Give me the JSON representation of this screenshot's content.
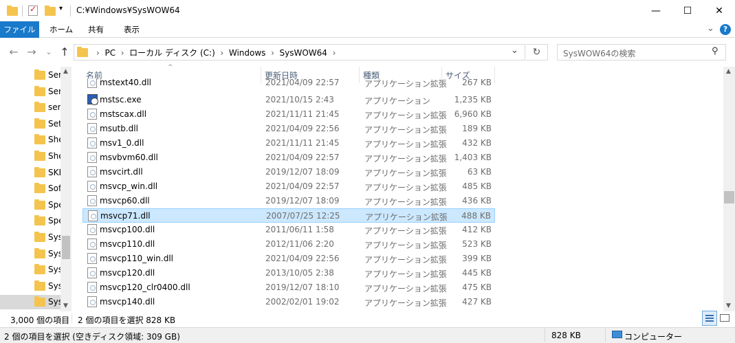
{
  "window": {
    "title": "C:¥Windows¥SysWOW64",
    "minimize": "—",
    "maximize": "☐",
    "close": "✕"
  },
  "ribbon": {
    "tabs": [
      "ファイル",
      "ホーム",
      "共有",
      "表示"
    ],
    "expand": "⌄",
    "help": "?"
  },
  "nav": {
    "back": "←",
    "forward": "→",
    "recent": "⌄",
    "up": "↑",
    "breadcrumbs": [
      "PC",
      "ローカル ディスク (C:)",
      "Windows",
      "SysWOW64"
    ],
    "separator": "›",
    "dropdown": "⌄",
    "refresh": "↻",
    "search_placeholder": "SysWOW64の検索"
  },
  "navpane": {
    "items": [
      "Ser",
      "Ser",
      "serv",
      "Set",
      "She",
      "She",
      "SKB",
      "Sof",
      "Spe",
      "Spe",
      "Sys",
      "Sys",
      "Sys",
      "Sys",
      "Sys"
    ]
  },
  "columns": {
    "name": "名前",
    "date": "更新日時",
    "type": "種類",
    "size": "サイズ"
  },
  "files": [
    {
      "name": "mstext40.dll",
      "date": "2021/04/09 22:57",
      "type": "アプリケーション拡張",
      "size": "267 KB",
      "icon": "dll"
    },
    {
      "name": "mstsc.exe",
      "date": "2021/10/15 2:43",
      "type": "アプリケーション",
      "size": "1,235 KB",
      "icon": "exe"
    },
    {
      "name": "mstscax.dll",
      "date": "2021/11/11 21:45",
      "type": "アプリケーション拡張",
      "size": "6,960 KB",
      "icon": "dll"
    },
    {
      "name": "msutb.dll",
      "date": "2021/04/09 22:56",
      "type": "アプリケーション拡張",
      "size": "189 KB",
      "icon": "dll"
    },
    {
      "name": "msv1_0.dll",
      "date": "2021/11/11 21:45",
      "type": "アプリケーション拡張",
      "size": "432 KB",
      "icon": "dll"
    },
    {
      "name": "msvbvm60.dll",
      "date": "2021/04/09 22:57",
      "type": "アプリケーション拡張",
      "size": "1,403 KB",
      "icon": "dll"
    },
    {
      "name": "msvcirt.dll",
      "date": "2019/12/07 18:09",
      "type": "アプリケーション拡張",
      "size": "63 KB",
      "icon": "dll"
    },
    {
      "name": "msvcp_win.dll",
      "date": "2021/04/09 22:57",
      "type": "アプリケーション拡張",
      "size": "485 KB",
      "icon": "dll"
    },
    {
      "name": "msvcp60.dll",
      "date": "2019/12/07 18:09",
      "type": "アプリケーション拡張",
      "size": "436 KB",
      "icon": "dll"
    },
    {
      "name": "msvcp71.dll",
      "date": "2007/07/25 12:25",
      "type": "アプリケーション拡張",
      "size": "488 KB",
      "icon": "dll",
      "selected": true
    },
    {
      "name": "msvcp100.dll",
      "date": "2011/06/11 1:58",
      "type": "アプリケーション拡張",
      "size": "412 KB",
      "icon": "dll"
    },
    {
      "name": "msvcp110.dll",
      "date": "2012/11/06 2:20",
      "type": "アプリケーション拡張",
      "size": "523 KB",
      "icon": "dll"
    },
    {
      "name": "msvcp110_win.dll",
      "date": "2021/04/09 22:56",
      "type": "アプリケーション拡張",
      "size": "399 KB",
      "icon": "dll"
    },
    {
      "name": "msvcp120.dll",
      "date": "2013/10/05 2:38",
      "type": "アプリケーション拡張",
      "size": "445 KB",
      "icon": "dll"
    },
    {
      "name": "msvcp120_clr0400.dll",
      "date": "2019/12/07 18:10",
      "type": "アプリケーション拡張",
      "size": "475 KB",
      "icon": "dll"
    },
    {
      "name": "msvcp140.dll",
      "date": "2002/02/01 19:02",
      "type": "アプリケーション拡張",
      "size": "427 KB",
      "icon": "dll"
    }
  ],
  "status": {
    "item_count": "3,000 個の項目",
    "selected": "2 個の項目を選択  828 KB"
  },
  "statusbar2": {
    "text": "2 個の項目を選択 (空きディスク領域: 309 GB)",
    "size": "828 KB",
    "computer": "コンピューター"
  },
  "colors": {
    "accent": "#1979ca",
    "selection": "#cce8ff",
    "folder": "#f4c44e"
  }
}
